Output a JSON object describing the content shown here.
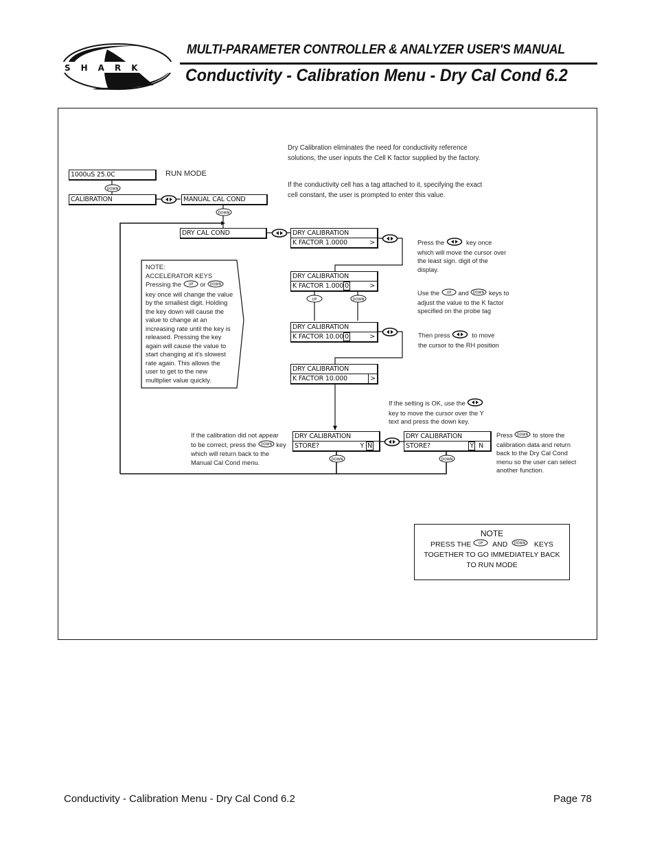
{
  "header": {
    "logo_text": "SHARK",
    "manual_title": "MULTI-PARAMETER CONTROLLER & ANALYZER USER'S MANUAL",
    "page_title": "Conductivity - Calibration Menu - Dry Cal Cond 6.2"
  },
  "keys": {
    "up": "UP",
    "down": "DOWN"
  },
  "intro": {
    "paragraph1": "Dry Calibration eliminates the need for conductivity reference solutions, the user inputs the Cell K factor supplied by the factory.",
    "paragraph2": "If the conductivity cell has a tag attached to it, specifying the exact cell constant, the user is prompted to enter this value."
  },
  "screens": {
    "run": {
      "line1": "1000uS   25.0C",
      "label": "RUN MODE"
    },
    "calibration": {
      "line1": "CALIBRATION"
    },
    "manual_cal_cond": {
      "line1": "MANUAL CAL COND"
    },
    "dry_cal_cond": {
      "line1": "DRY CAL COND"
    },
    "kf1": {
      "line1": "DRY CALIBRATION",
      "line2": "K FACTOR  1.0000",
      "arrow": ">"
    },
    "kf2": {
      "line1": "DRY CALIBRATION",
      "line2_prefix": "K FACTOR  1.000",
      "cursor": "0",
      "arrow": ">"
    },
    "kf3": {
      "line1": "DRY CALIBRATION",
      "line2_prefix": "K FACTOR  10.00",
      "cursor": "0",
      "arrow": ">"
    },
    "kf4": {
      "line1": "DRY CALIBRATION",
      "line2": "K FACTOR  10.000",
      "cursor_arrow": ">"
    },
    "store_n": {
      "line1": "DRY CALIBRATION",
      "line2": "STORE?",
      "y": "Y",
      "n": "N",
      "selected": "N"
    },
    "store_y": {
      "line1": "DRY CALIBRATION",
      "line2": "STORE?",
      "y": "Y",
      "n": "N",
      "selected": "Y"
    }
  },
  "notes": {
    "accelerator": {
      "title": "NOTE:",
      "subtitle": "ACCELERATOR KEYS",
      "pre": "Pressing the",
      "or": "or",
      "body": "key once will change the value by the smallest digit. Holding the key down will cause the value to change at an increasing rate until the key is released. Pressing the key again will cause the value to start changing at it's slowest rate again. This allows the user to get to the new multiplier value quickly."
    },
    "press_once": {
      "pre": "Press the",
      "post": "key once which will move the cursor over the least sign. digit of the display."
    },
    "use_keys": {
      "pre": "Use the",
      "and": "and",
      "post": "keys to",
      "rest": "adjust the value to the K factor specified on the probe tag"
    },
    "then_press": {
      "pre": "Then press",
      "post": "to move",
      "rest": "the cursor to the RH position"
    },
    "setting_ok": {
      "pre": "If the setting is OK, use the",
      "rest": "key to move the cursor over the Y text and press the down key."
    },
    "not_correct": {
      "line1": "If the calibration did not appear",
      "pre": "to be correct, press the",
      "rest": "key which will return back to the Manual Cal Cond menu."
    },
    "store": {
      "pre": "Press",
      "post": "to store the",
      "rest": "calibration data and return back to the Dry Cal Cond menu so the user can select another function."
    },
    "run_mode": {
      "title": "NOTE",
      "pre": "PRESS THE",
      "and": "AND",
      "post": "KEYS",
      "rest": "TOGETHER TO GO IMMEDIATELY BACK TO RUN MODE"
    }
  },
  "footer": {
    "title": "Conductivity - Calibration Menu - Dry Cal Cond 6.2",
    "page": "Page 78"
  }
}
